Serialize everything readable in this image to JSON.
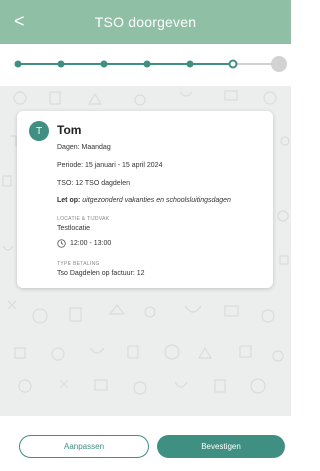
{
  "header": {
    "back_label": "<",
    "title": "TSO doorgeven"
  },
  "stepper": {
    "total_steps": 7,
    "completed_steps": 6,
    "current_step": 6,
    "accent_color": "#3f8f82",
    "inactive_color": "#d2d2d2"
  },
  "card": {
    "avatar_initial": "T",
    "name": "Tom",
    "days": "Dagen: Maandag",
    "period": "Periode: 15 januari - 15 april 2024",
    "tso": "TSO: 12 TSO dagdelen",
    "note_bold": "Let op:",
    "note_text": "uitgezonderd vakanties en schoolsluitingsdagen",
    "location_label": "LOCATIE & TIJDVAK",
    "location": "Testlocatie",
    "time": "12:00 - 13:00",
    "payment_label": "TYPE BETALING",
    "payment": "Tso Dagdelen op factuur: 12"
  },
  "buttons": {
    "adjust": "Aanpassen",
    "confirm": "Bevestigen"
  },
  "colors": {
    "header_bg": "#8fbfa5",
    "accent": "#3f8f82",
    "background": "#eceeed"
  }
}
